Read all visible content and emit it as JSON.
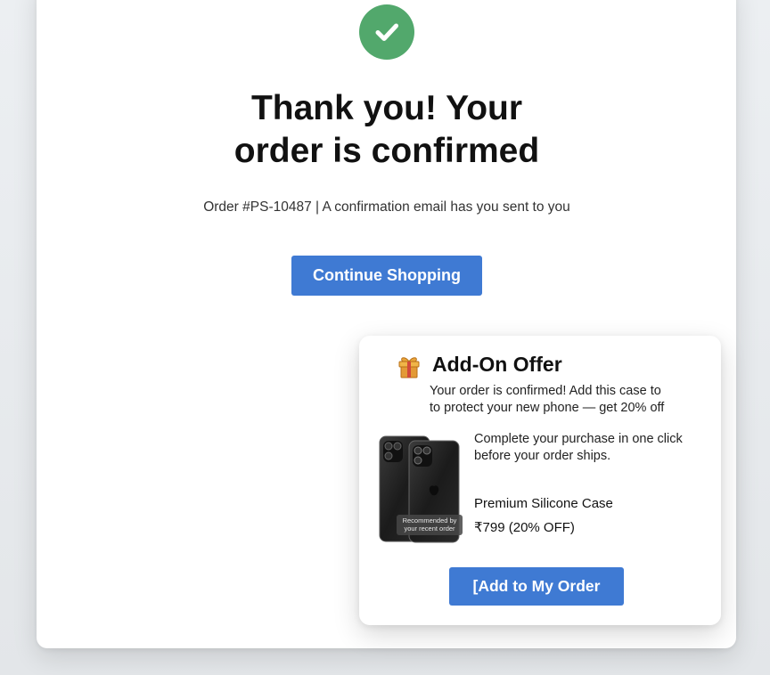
{
  "confirmation": {
    "headline_line1": "Thank you! Your",
    "headline_line2": "order is confirmed",
    "subline": "Order #PS-10487 | A confirmation email has you sent to you",
    "continue_label": "Continue Shopping"
  },
  "offer": {
    "title": "Add-On Offer",
    "description_line1": "Your order is confirmed! Add this case to",
    "description_line2": "to protect your new phone — get 20% off",
    "note_line1": "Complete your purchase in one click",
    "note_line2": "before your order ships.",
    "product_name": "Premium Silicone Case",
    "price": "₹799 (20% OFF)",
    "image_caption_line1": "Recommended by",
    "image_caption_line2": "your recent order",
    "add_label": "[Add to My Order"
  },
  "colors": {
    "accent_blue": "#3f7ad3",
    "success_green": "#52a86c"
  },
  "icons": {
    "confirmation": "check-circle-icon",
    "offer": "gift-icon"
  }
}
